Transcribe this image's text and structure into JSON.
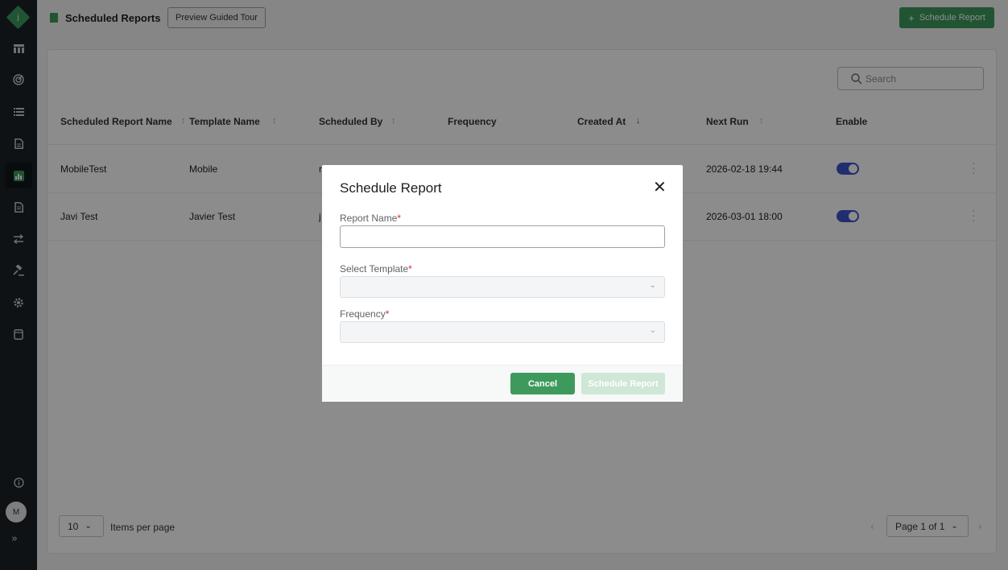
{
  "app": {
    "logo_letter": "j",
    "avatar_initial": "M"
  },
  "header": {
    "title": "Scheduled Reports",
    "tour_button": "Preview Guided Tour",
    "schedule_button": "Schedule Report",
    "accent_color": "#3d9a5c"
  },
  "sidebar": {
    "items": [
      {
        "icon": "dashboard-icon"
      },
      {
        "icon": "radar-icon"
      },
      {
        "icon": "list-icon"
      },
      {
        "icon": "document-icon"
      },
      {
        "icon": "bar-chart-icon",
        "active": true
      },
      {
        "icon": "report-icon"
      },
      {
        "icon": "transfer-icon"
      },
      {
        "icon": "gavel-icon"
      },
      {
        "icon": "gear-icon"
      },
      {
        "icon": "database-icon"
      }
    ],
    "info_icon": "info-icon",
    "expand_icon": "expand-icon"
  },
  "search": {
    "placeholder": "Search"
  },
  "table": {
    "columns": [
      "Scheduled Report Name",
      "Template Name",
      "Scheduled By",
      "Frequency",
      "Created At",
      "Next Run",
      "Enable"
    ],
    "rows": [
      {
        "name": "MobileTest",
        "template": "Mobile",
        "scheduled_by": "r",
        "next_run": "2026-02-18 19:44",
        "enabled": true
      },
      {
        "name": "Javi Test",
        "template": "Javier Test",
        "scheduled_by": "j",
        "next_run": "2026-03-01 18:00",
        "enabled": true
      }
    ]
  },
  "pagination": {
    "per_page": "10",
    "per_page_label": "Items per page",
    "page_label": "Page 1 of 1"
  },
  "modal": {
    "title": "Schedule Report",
    "fields": {
      "report_name": {
        "label": "Report Name",
        "value": ""
      },
      "template": {
        "label": "Select Template",
        "value": ""
      },
      "frequency": {
        "label": "Frequency",
        "value": ""
      }
    },
    "required_marker": "*",
    "cancel_label": "Cancel",
    "submit_label": "Schedule Report"
  }
}
